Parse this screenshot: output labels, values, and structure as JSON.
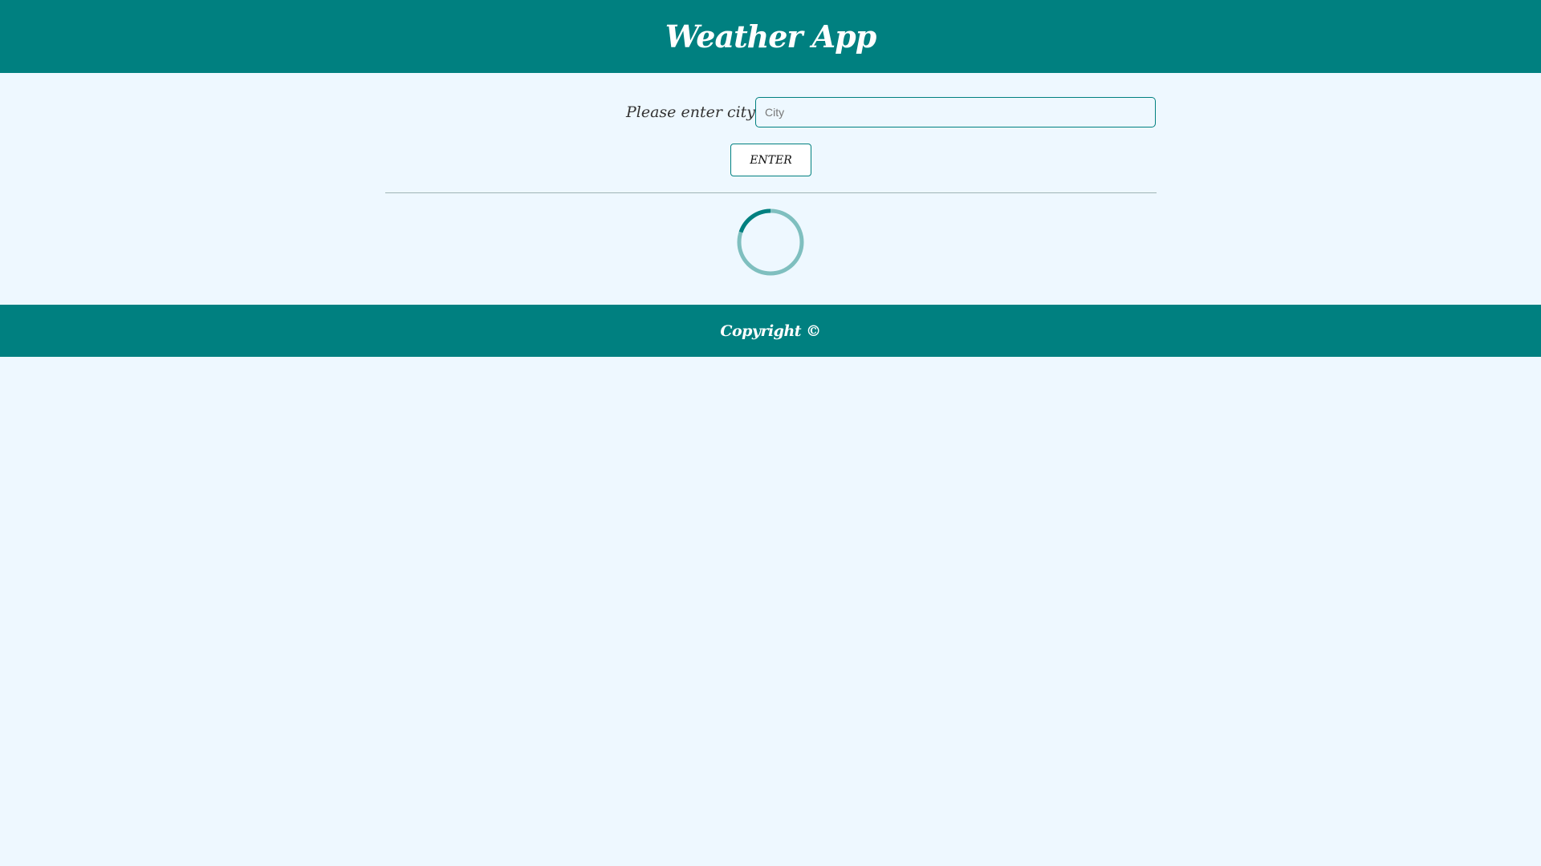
{
  "header": {
    "title": "Weather App"
  },
  "search": {
    "label": "Please enter city:",
    "placeholder": "City",
    "value": "",
    "button_label": "ENTER"
  },
  "footer": {
    "copyright": "Copyright ©"
  },
  "colors": {
    "accent": "#008080",
    "background": "#eef8ff",
    "spinner_track": "#7fbfbf"
  },
  "status": {
    "loading": true
  }
}
